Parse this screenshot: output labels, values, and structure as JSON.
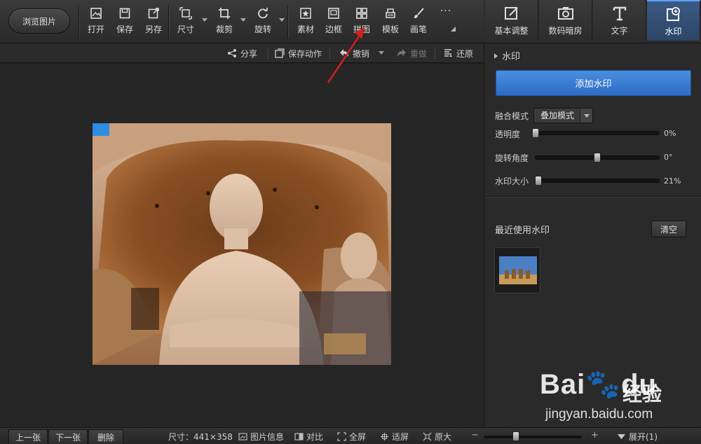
{
  "toolbar": {
    "browse_label": "浏览图片",
    "tools": [
      {
        "label": "打开",
        "icon": "open-image-icon"
      },
      {
        "label": "保存",
        "icon": "save-disk-icon"
      },
      {
        "label": "另存",
        "icon": "save-as-icon"
      },
      {
        "label": "尺寸",
        "icon": "resize-icon"
      },
      {
        "label": "裁剪",
        "icon": "crop-icon"
      },
      {
        "label": "旋转",
        "icon": "rotate-icon"
      },
      {
        "label": "素材",
        "icon": "star-material-icon"
      },
      {
        "label": "边框",
        "icon": "frame-icon"
      },
      {
        "label": "拼图",
        "icon": "collage-grid-icon"
      },
      {
        "label": "模板",
        "icon": "template-icon"
      },
      {
        "label": "画笔",
        "icon": "brush-icon"
      }
    ],
    "more_label": "···"
  },
  "actionbar": {
    "share": "分享",
    "save_action": "保存动作",
    "undo": "撤销",
    "redo": "重做",
    "restore": "还原"
  },
  "right_tabs": [
    {
      "label": "基本调整",
      "icon": "adjust-icon"
    },
    {
      "label": "数码暗房",
      "icon": "camera-icon"
    },
    {
      "label": "文字",
      "icon": "text-icon"
    },
    {
      "label": "水印",
      "icon": "watermark-icon",
      "active": true
    }
  ],
  "watermark_panel": {
    "section_title": "水印",
    "add_button": "添加水印",
    "blend_label": "融合模式",
    "blend_value": "叠加模式",
    "opacity_label": "透明度",
    "opacity_value": "0%",
    "opacity_fraction": 0.0,
    "rotation_label": "旋转角度",
    "rotation_value": "0°",
    "rotation_fraction": 0.5,
    "size_label": "水印大小",
    "size_value": "21%",
    "size_fraction": 0.02,
    "recent_title": "最近使用水印",
    "clear_button": "清空"
  },
  "bottombar": {
    "prev": "上一张",
    "next": "下一张",
    "delete": "删除",
    "dimensions": "尺寸：441×358",
    "info": "图片信息",
    "compare": "对比",
    "fullscreen": "全屏",
    "fit": "适屏",
    "original": "原大",
    "zoom_minus": "−",
    "zoom_plus": "+",
    "zoom_fraction": 0.33,
    "expand": "展开(1)"
  },
  "watermark_overlay": {
    "brand": "Bai",
    "brand_suffix": "du",
    "cn": "经验",
    "url": "jingyan.baidu.com"
  },
  "colors": {
    "accent_blue": "#2c6cc4",
    "active_tab": "#2b4566",
    "arrow_red": "#d21f1f"
  }
}
